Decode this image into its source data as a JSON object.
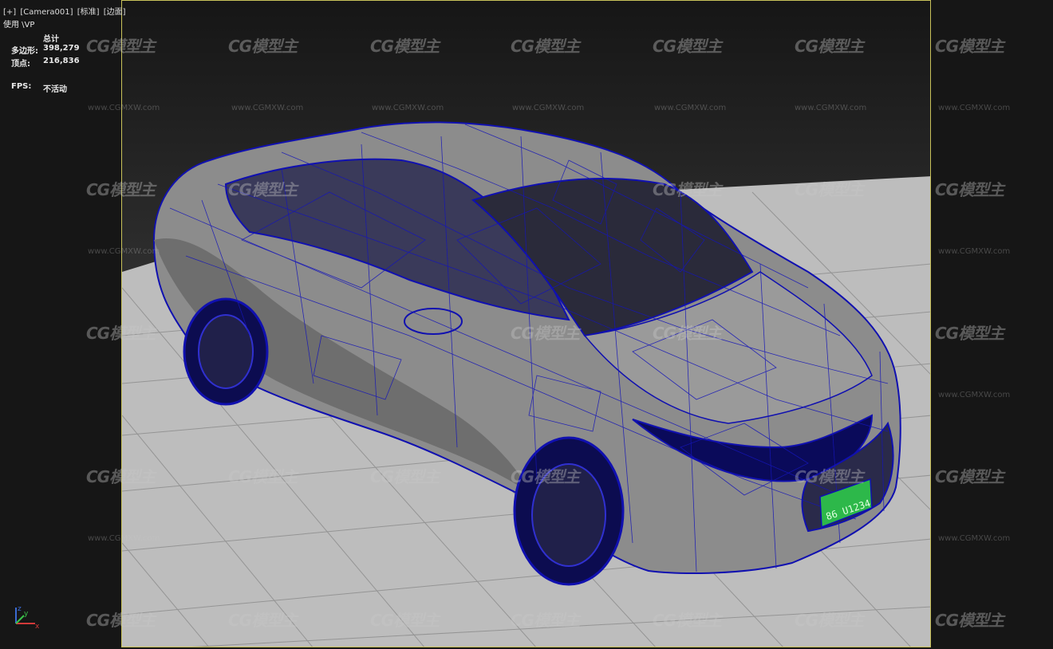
{
  "viewport": {
    "label_plus": "[+]",
    "label_camera": "[Camera001]",
    "label_shading": "[标准]",
    "label_edges": "[边面]",
    "using_label": "使用 \\VP"
  },
  "stats": {
    "total_header": "总计",
    "polygons_label": "多边形:",
    "polygons_value": "398,279",
    "vertices_label": "顶点:",
    "vertices_value": "216,836",
    "fps_label": "FPS:",
    "fps_value": "不活动"
  },
  "watermark": {
    "logo_text": "CG模型主",
    "site_text": "www.CGMXW.com"
  },
  "license_plate": "86 U1234",
  "axis": {
    "x": "x",
    "y": "y",
    "z": "z"
  },
  "colors": {
    "wire": "#1010b0",
    "frame": "#c9c25a",
    "plate": "#2db84a"
  }
}
